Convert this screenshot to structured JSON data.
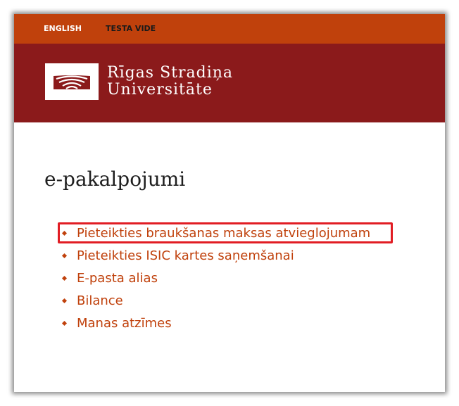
{
  "topbar": {
    "language_link": "ENGLISH",
    "environment_label": "TESTA VIDE",
    "color": "#c0410c"
  },
  "header": {
    "color": "#8b1a1b",
    "logo_icon": "rsu-emblem-icon",
    "university_name_line1": "Rīgas Stradiņa",
    "university_name_line2": "Universitāte"
  },
  "page": {
    "title": "e-pakalpojumi"
  },
  "services": [
    {
      "label": "Pieteikties braukšanas maksas atvieglojumam",
      "highlighted": true
    },
    {
      "label": "Pieteikties ISIC kartes saņemšanai",
      "highlighted": false
    },
    {
      "label": "E-pasta alias",
      "highlighted": false
    },
    {
      "label": "Bilance",
      "highlighted": false
    },
    {
      "label": "Manas atzīmes",
      "highlighted": false
    }
  ],
  "colors": {
    "link": "#c0410c",
    "highlight_border": "#e11d24"
  }
}
